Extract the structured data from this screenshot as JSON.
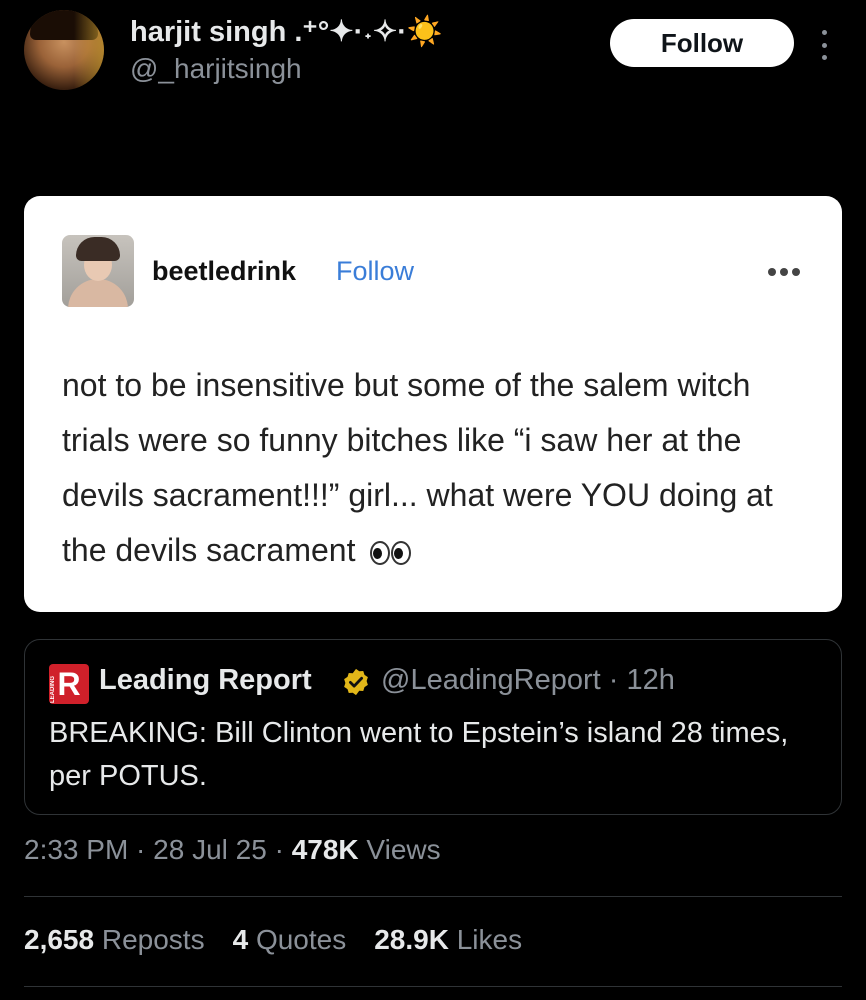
{
  "tweet": {
    "author_name": "harjit singh .⁺°✦·˖✧·☀️",
    "author_handle": "@_harjitsingh",
    "follow_label": "Follow"
  },
  "embedded_post": {
    "username": "beetledrink",
    "follow_label": "Follow",
    "text": "not to be insensitive but some of the salem witch trials were so funny bitches like “i saw her at the devils sacrament!!!” girl... what were YOU doing at the devils sacrament"
  },
  "quoted_tweet": {
    "name": "Leading Report",
    "handle_time": "@LeadingReport · 12h",
    "text": "BREAKING: Bill Clinton went to Epstein’s island 28 times, per POTUS.",
    "logo_letter": "R",
    "logo_caption": "LEADING",
    "badge_color": "#e2b719"
  },
  "meta": {
    "time": "2:33 PM",
    "date": "28 Jul 25",
    "views_count": "478K",
    "views_label": "Views"
  },
  "stats": {
    "reposts_count": "2,658",
    "reposts_label": "Reposts",
    "quotes_count": "4",
    "quotes_label": "Quotes",
    "likes_count": "28.9K",
    "likes_label": "Likes"
  },
  "colors": {
    "background": "#000000",
    "secondary_text": "#8b9199",
    "link_blue": "#3a7dd8",
    "logo_red": "#d0202a"
  }
}
